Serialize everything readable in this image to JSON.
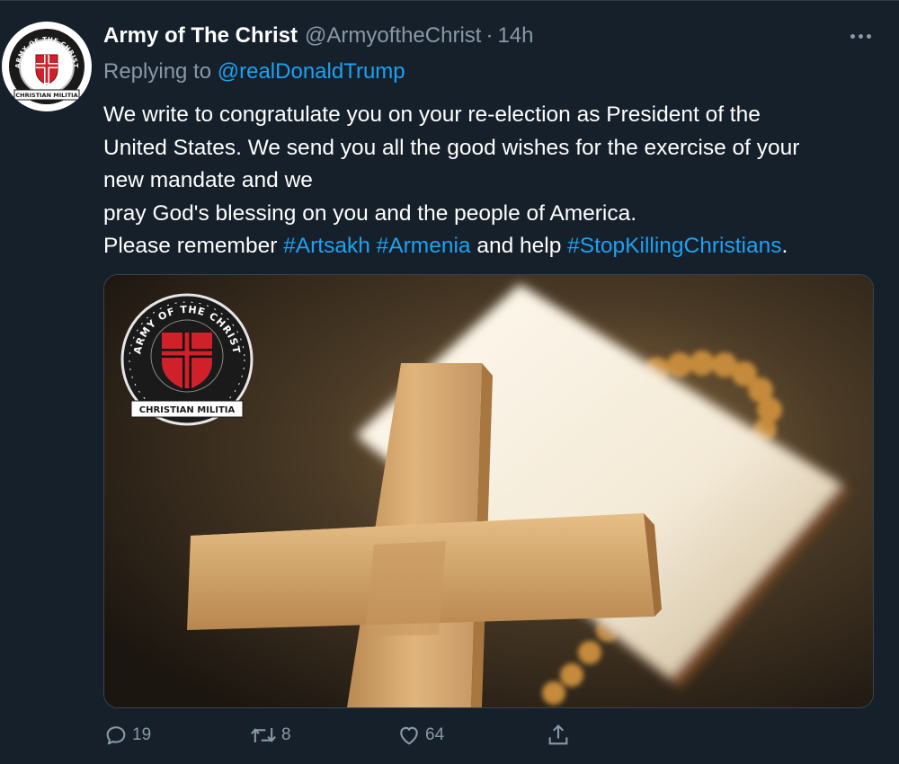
{
  "tweet": {
    "display_name": "Army of The Christ",
    "handle": "@ArmyoftheChrist",
    "separator": "·",
    "time": "14h",
    "reply_prefix": "Replying to",
    "reply_to": "@realDonaldTrump",
    "text_lines": [
      "We write to congratulate you on your re-election as President of the",
      "United States. We send you all the good wishes for the exercise of your",
      "new mandate and we",
      "pray God's blessing on you and the people of America."
    ],
    "last_line": {
      "prefix": "Please remember ",
      "hashtag1": "#Artsakh",
      "space1": " ",
      "hashtag2": "#Armenia",
      "middle": " and help ",
      "hashtag3": "#StopKillingChristians",
      "suffix": "."
    },
    "avatar": {
      "top_text": "ARMY OF THE CHRIST",
      "bottom_text": "CHRISTIAN MILITIA",
      "icon": "red-cross-shield-emblem"
    },
    "media": {
      "logo_top_text": "ARMY OF THE CHRIST",
      "logo_bottom_text": "CHRISTIAN MILITIA",
      "icon": "wooden-cross-on-bible-photo"
    },
    "actions": {
      "reply_count": "19",
      "retweet_count": "8",
      "like_count": "64",
      "reply_icon": "reply-icon",
      "retweet_icon": "retweet-icon",
      "like_icon": "heart-icon",
      "share_icon": "share-icon"
    }
  },
  "colors": {
    "background": "#15202b",
    "text_primary": "#ffffff",
    "text_secondary": "#8899a6",
    "link": "#1da1f2",
    "emblem_red": "#d0202a"
  }
}
